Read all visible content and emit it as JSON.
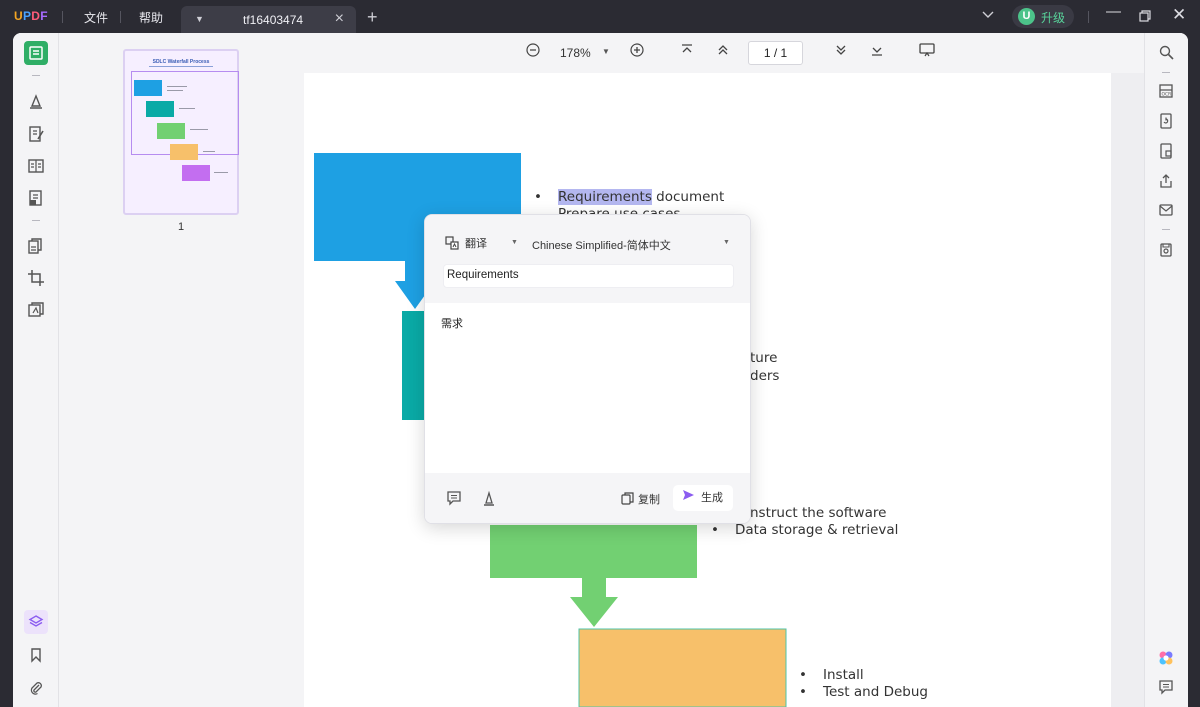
{
  "app": {
    "logo": "UPDF"
  },
  "menu": {
    "file": "文件",
    "help": "帮助"
  },
  "tab": {
    "name": "tf16403474"
  },
  "account": {
    "avatar_letter": "U",
    "upgrade_label": "升级"
  },
  "toolbar": {
    "zoom": "178%",
    "page_indicator": "1 / 1"
  },
  "thumbnail": {
    "page_number": "1",
    "title": "SDLC Waterfall Process"
  },
  "document": {
    "bullets_1": [
      "Requirements",
      " document",
      "Prepare use cases"
    ],
    "bullets_2": [
      "ture",
      "ders"
    ],
    "bullets_3": [
      "nstruct the software",
      "Data storage & retrieval"
    ],
    "bullets_4": [
      "Install",
      "Test and Debug"
    ]
  },
  "translate_popup": {
    "mode": "翻译",
    "target_language": "Chinese Simplified-简体中文",
    "source_text": "Requirements",
    "result_text": "需求",
    "copy_label": "复制",
    "generate_label": "生成"
  },
  "colors": {
    "blue": "#1ea0e3",
    "teal": "#0aaaa6",
    "green": "#72d072",
    "orange": "#f7c06a",
    "purple": "#c36ef0",
    "accent": "#2fae66"
  }
}
